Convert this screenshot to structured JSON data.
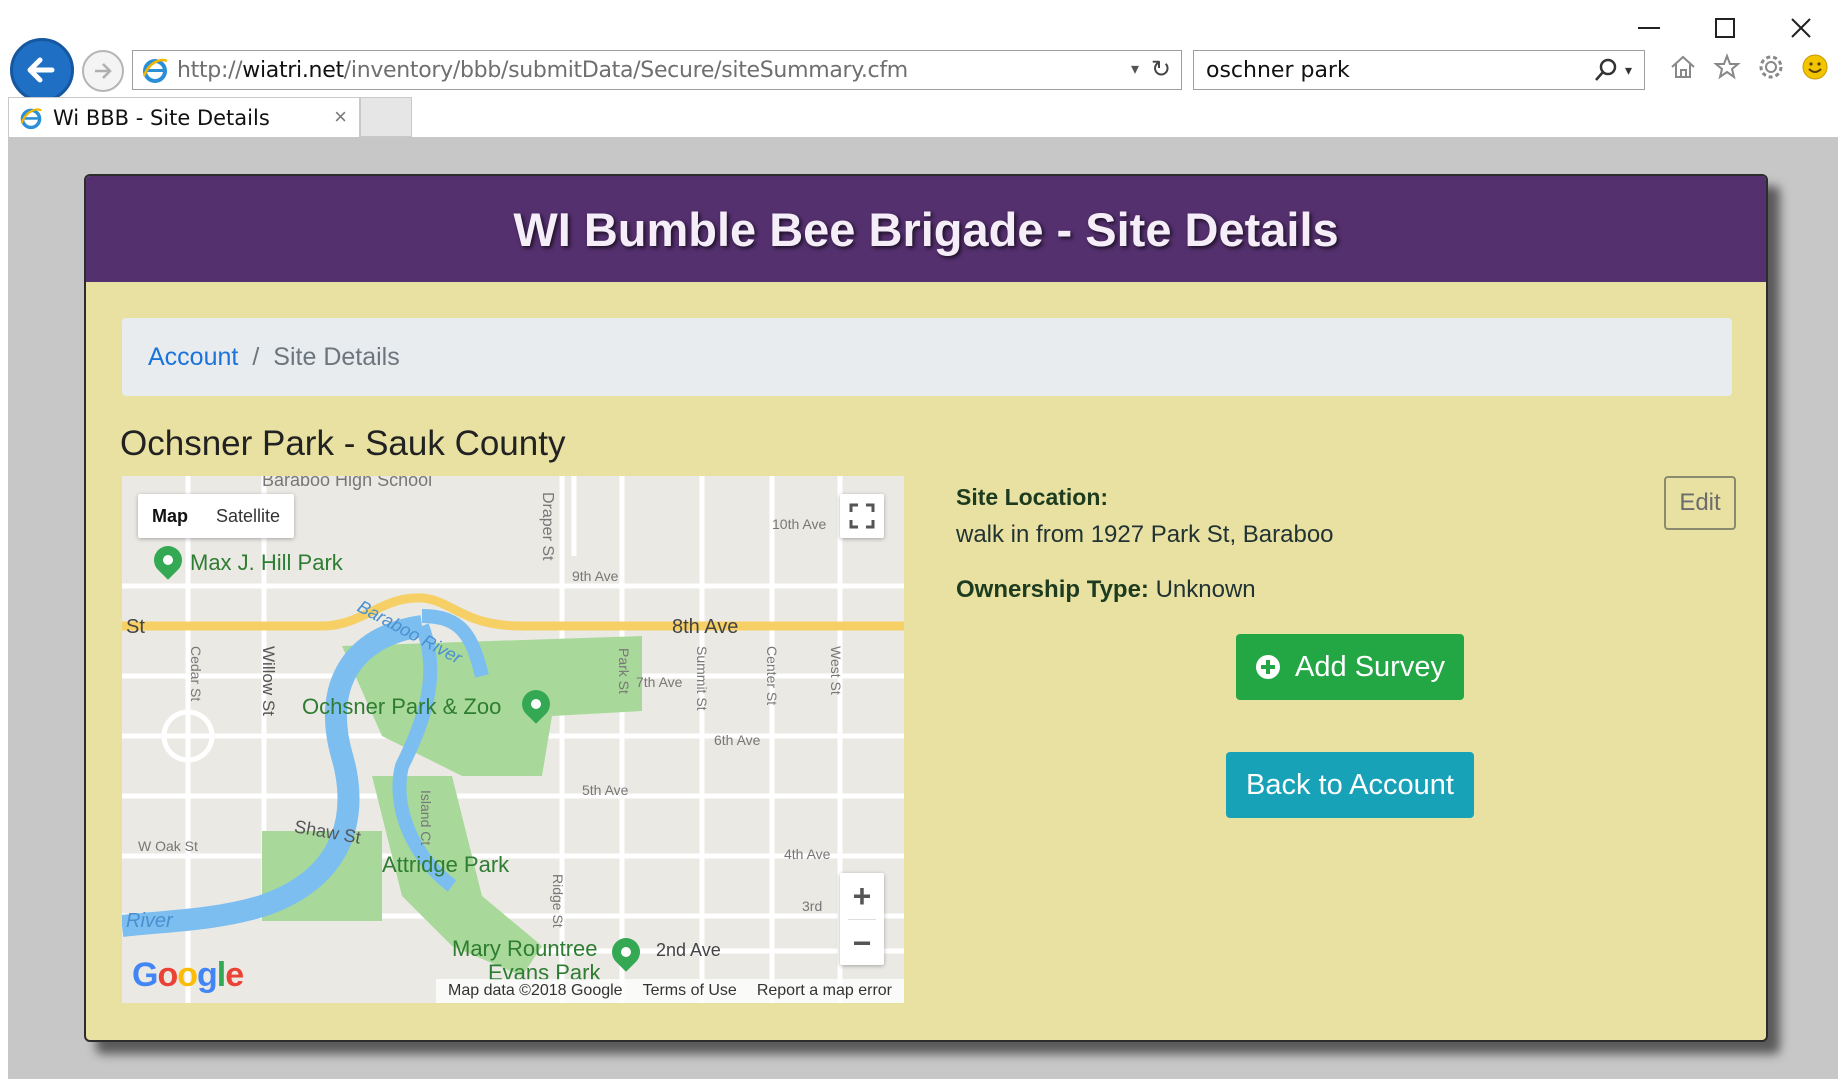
{
  "browser": {
    "url_prefix": "http://",
    "url_domain": "wiatri.net",
    "url_path": "/inventory/bbb/submitData/Secure/siteSummary.cfm",
    "search_query": "oschner park",
    "tab_title": "Wi BBB - Site Details"
  },
  "page": {
    "header_title": "WI Bumble Bee Brigade - Site Details",
    "breadcrumb": {
      "link": "Account",
      "separator": "/",
      "current": "Site Details"
    },
    "site_title": "Ochsner Park - Sauk County",
    "site_location_label": "Site Location:",
    "site_location_value": "walk in from 1927 Park St, Baraboo",
    "ownership_label": "Ownership Type:",
    "ownership_value": "Unknown",
    "edit_label": "Edit",
    "add_survey_label": "Add Survey",
    "back_label": "Back to Account"
  },
  "map": {
    "type_map": "Map",
    "type_satellite": "Satellite",
    "labels": {
      "max_hill": "Max J. Hill Park",
      "ochsner_zoo": "Ochsner Park & Zoo",
      "attridge": "Attridge Park",
      "mary_rountree": "Mary Rountree",
      "evans_park": "Evans Park",
      "baraboo_river": "Baraboo River",
      "river": "River"
    },
    "streets": {
      "eighth": "8th Ave",
      "st": "St",
      "tenth": "10th Ave",
      "ninth": "9th Ave",
      "seventh": "7th Ave",
      "sixth": "6th Ave",
      "fifth": "5th Ave",
      "fourth": "4th Ave",
      "third": "3rd",
      "second": "2nd Ave",
      "draper": "Draper St",
      "willow": "Willow St",
      "cedar": "Cedar St",
      "park": "Park St",
      "summit": "Summit St",
      "center": "Center St",
      "west": "West St",
      "shaw": "Shaw St",
      "island": "Island Ct",
      "ridge": "Ridge St",
      "oak": "W Oak St",
      "high_school": "Baraboo High School"
    },
    "attribution": "Map data ©2018 Google",
    "terms": "Terms of Use",
    "report": "Report a map error",
    "zoom_in": "+",
    "zoom_out": "−"
  },
  "colors": {
    "header_bg": "#55306f",
    "card_bg": "#e8e1a2",
    "success": "#23a745",
    "info": "#17a2b8",
    "link": "#1a73d9"
  }
}
